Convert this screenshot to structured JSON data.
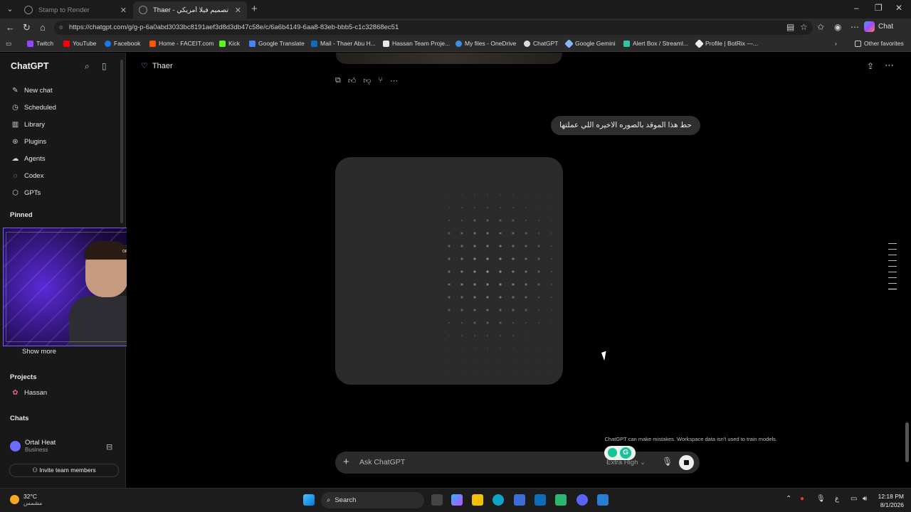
{
  "browser": {
    "tabs": [
      {
        "title": "Stamp to Render",
        "active": false
      },
      {
        "title": "Thaer - تصميم فيلا أمريكي",
        "active": true
      }
    ],
    "url": "https://chatgpt.com/g/g-p-6a0abd3033bc8191aef3d8d3db47c58e/c/6a6b4149-6aa8-83eb-bbb5-c1c32868ec51",
    "copilot_label": "Chat",
    "bookmarks": [
      "Twitch",
      "YouTube",
      "Facebook",
      "Home - FACEIT.com",
      "Kick",
      "Google Translate",
      "Mail - Thaer Abu H...",
      "Hassan Team Proje...",
      "My files - OneDrive",
      "ChatGPT",
      "Google Gemini",
      "Alert Box / Streaml...",
      "Profile | BotRix —..."
    ],
    "other_favorites": "Other favorites"
  },
  "sidebar": {
    "title": "ChatGPT",
    "items": [
      {
        "label": "New chat",
        "icon": "edit-icon"
      },
      {
        "label": "Scheduled",
        "icon": "clock-icon"
      },
      {
        "label": "Library",
        "icon": "library-icon"
      },
      {
        "label": "Plugins",
        "icon": "plugin-icon"
      },
      {
        "label": "Agents",
        "icon": "agent-icon"
      },
      {
        "label": "Codex",
        "icon": "codex-icon"
      },
      {
        "label": "GPTs",
        "icon": "gpts-icon"
      }
    ],
    "pinned_label": "Pinned",
    "show_more": "Show more",
    "projects_label": "Projects",
    "project": "Hassan",
    "chats_label": "Chats",
    "user": {
      "name": "Ortal Heat",
      "plan": "Business"
    },
    "invite": "Invite team members"
  },
  "main": {
    "gpt_name": "Thaer",
    "user_message": "حط هذا الموقد بالصوره الاخيره اللي عملتها",
    "disclaimer": "ChatGPT can make mistakes. Workspace data isn't used to train models.",
    "composer_placeholder": "Ask ChatGPT",
    "mode_label": "Extra High"
  },
  "taskbar": {
    "temperature": "32°C",
    "weather_desc": "مشمس",
    "search_label": "Search",
    "time": "12:18 PM",
    "date": "8/1/2026",
    "lang": "ع"
  },
  "webcam": {
    "logo_text": "OFFICE"
  },
  "colors": {
    "accent": "#9fa6ff",
    "card": "#2b2b2b",
    "bubble": "#2f2f2f"
  }
}
